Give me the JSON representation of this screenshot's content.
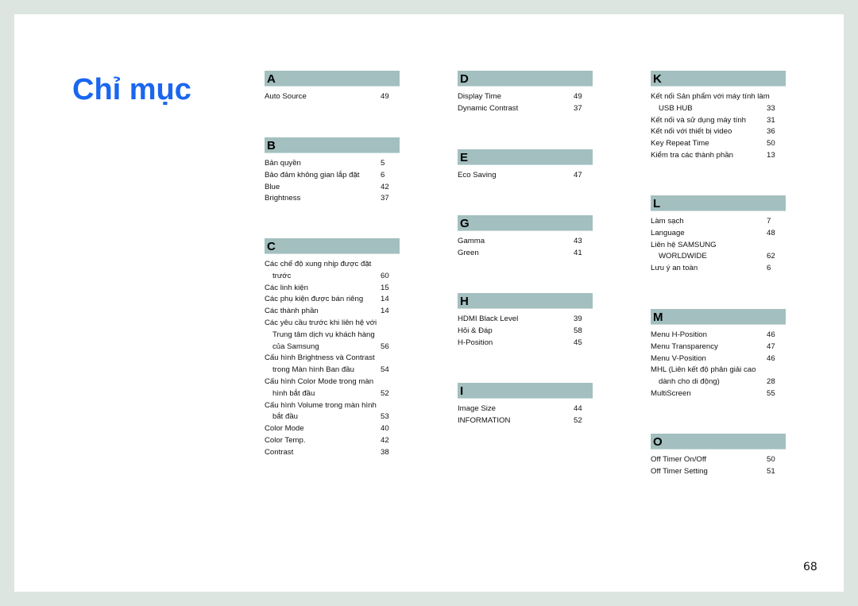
{
  "title": "Chỉ mục",
  "page_number": "68",
  "sections": {
    "A": {
      "letter": "A",
      "entries": [
        {
          "label": "Auto Source",
          "page": "49"
        }
      ]
    },
    "B": {
      "letter": "B",
      "entries": [
        {
          "label": "Bản quyền",
          "page": "5"
        },
        {
          "label": "Bảo đảm không gian lắp đặt",
          "page": "6"
        },
        {
          "label": "Blue",
          "page": "42"
        },
        {
          "label": "Brightness",
          "page": "37"
        }
      ]
    },
    "C": {
      "letter": "C",
      "entries": [
        {
          "label": "Các chế độ xung nhịp được đặt",
          "page": ""
        },
        {
          "label": "trước",
          "page": "60"
        },
        {
          "label": "Các linh kiện",
          "page": "15"
        },
        {
          "label": "Các phụ kiện được bán riêng",
          "page": "14"
        },
        {
          "label": "Các thành phần",
          "page": "14"
        },
        {
          "label": "Các yêu cầu trước khi liên hệ với",
          "page": ""
        },
        {
          "label": "Trung tâm dịch vụ khách hàng",
          "page": ""
        },
        {
          "label": "của Samsung",
          "page": "56"
        },
        {
          "label": "Cấu hình Brightness và Contrast",
          "page": ""
        },
        {
          "label": "trong Màn hình Ban đầu",
          "page": "54"
        },
        {
          "label": "Cấu hình Color Mode trong màn",
          "page": ""
        },
        {
          "label": "hình bắt đầu",
          "page": "52"
        },
        {
          "label": "Cấu hình Volume trong màn hình",
          "page": ""
        },
        {
          "label": "bắt đầu",
          "page": "53"
        },
        {
          "label": "Color Mode",
          "page": "40"
        },
        {
          "label": "Color Temp.",
          "page": "42"
        },
        {
          "label": "Contrast",
          "page": "38"
        }
      ]
    },
    "D": {
      "letter": "D",
      "entries": [
        {
          "label": "Display Time",
          "page": "49"
        },
        {
          "label": "Dynamic Contrast",
          "page": "37"
        }
      ]
    },
    "E": {
      "letter": "E",
      "entries": [
        {
          "label": "Eco Saving",
          "page": "47"
        }
      ]
    },
    "G": {
      "letter": "G",
      "entries": [
        {
          "label": "Gamma",
          "page": "43"
        },
        {
          "label": "Green",
          "page": "41"
        }
      ]
    },
    "H": {
      "letter": "H",
      "entries": [
        {
          "label": "HDMI Black Level",
          "page": "39"
        },
        {
          "label": "Hỏi & Đáp",
          "page": "58"
        },
        {
          "label": "H-Position",
          "page": "45"
        }
      ]
    },
    "I": {
      "letter": "I",
      "entries": [
        {
          "label": "Image Size",
          "page": "44"
        },
        {
          "label": "INFORMATION",
          "page": "52"
        }
      ]
    },
    "K": {
      "letter": "K",
      "entries": [
        {
          "label": "Kết nối Sản phẩm với máy tính làm",
          "page": ""
        },
        {
          "label": "USB HUB",
          "page": "33"
        },
        {
          "label": "Kết nối và sử dụng máy tính",
          "page": "31"
        },
        {
          "label": "Kết nối với thiết bị video",
          "page": "36"
        },
        {
          "label": "Key Repeat Time",
          "page": "50"
        },
        {
          "label": "Kiểm tra các thành phần",
          "page": "13"
        }
      ]
    },
    "L": {
      "letter": "L",
      "entries": [
        {
          "label": "Làm sạch",
          "page": "7"
        },
        {
          "label": "Language",
          "page": "48"
        },
        {
          "label": "Liên hệ SAMSUNG",
          "page": ""
        },
        {
          "label": "WORLDWIDE",
          "page": "62"
        },
        {
          "label": "Lưu ý an toàn",
          "page": "6"
        }
      ]
    },
    "M": {
      "letter": "M",
      "entries": [
        {
          "label": "Menu H-Position",
          "page": "46"
        },
        {
          "label": "Menu Transparency",
          "page": "47"
        },
        {
          "label": "Menu V-Position",
          "page": "46"
        },
        {
          "label": "MHL (Liên kết độ phân giải cao",
          "page": ""
        },
        {
          "label": "dành cho di động)",
          "page": "28"
        },
        {
          "label": "MultiScreen",
          "page": "55"
        }
      ]
    },
    "O": {
      "letter": "O",
      "entries": [
        {
          "label": "Off Timer On/Off",
          "page": "50"
        },
        {
          "label": "Off Timer Setting",
          "page": "51"
        }
      ]
    }
  }
}
